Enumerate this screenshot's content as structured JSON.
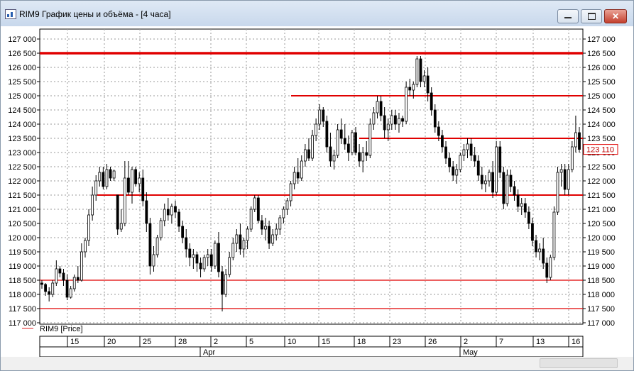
{
  "window": {
    "title": "RIM9 График цены и объёма - [4 часа]"
  },
  "legend": {
    "series_label": "RIM9 [Price]",
    "line_color": "#e02020"
  },
  "colors": {
    "candle": "#000000",
    "level": "#e00000",
    "grid": "#9a9a9a"
  },
  "chart_data": {
    "type": "candlestick",
    "title": "",
    "ylim": [
      117000,
      127000
    ],
    "yticks": [
      117000,
      117500,
      118000,
      118500,
      119000,
      119500,
      120000,
      120500,
      121000,
      121500,
      122000,
      122500,
      123000,
      123500,
      124000,
      124500,
      125000,
      125500,
      126000,
      126500,
      127000
    ],
    "last_price": "123 110",
    "xtick_labels": [
      "15",
      "20",
      "25",
      "28",
      "2",
      "5",
      "10",
      "15",
      "18",
      "23",
      "26",
      "2",
      "7",
      "13",
      "16"
    ],
    "month_labels": [
      "Apr",
      "May"
    ],
    "levels": [
      {
        "value": 126500,
        "thickness": "thick"
      },
      {
        "value": 125000,
        "thickness": "medium"
      },
      {
        "value": 123500,
        "thickness": "medium"
      },
      {
        "value": 121500,
        "thickness": "medium"
      },
      {
        "value": 118500,
        "thickness": "thin"
      },
      {
        "value": 117500,
        "thickness": "thin"
      }
    ],
    "candles": [
      [
        1,
        118400,
        118500,
        118200,
        118350
      ],
      [
        2,
        118350,
        118400,
        117950,
        118100
      ],
      [
        3,
        118100,
        118250,
        117750,
        118000
      ],
      [
        4,
        118000,
        118500,
        117900,
        118400
      ],
      [
        5,
        118400,
        119200,
        118300,
        118900
      ],
      [
        6,
        118900,
        119000,
        118600,
        118750
      ],
      [
        7,
        118750,
        118900,
        118300,
        118500
      ],
      [
        8,
        118500,
        118700,
        117800,
        117900
      ],
      [
        9,
        117900,
        118300,
        117850,
        118200
      ],
      [
        10,
        118200,
        118700,
        118100,
        118600
      ],
      [
        11,
        118600,
        119000,
        118400,
        118500
      ],
      [
        12,
        118500,
        119800,
        118450,
        119500
      ],
      [
        13,
        119500,
        120000,
        119300,
        119900
      ],
      [
        14,
        119900,
        121000,
        119700,
        120800
      ],
      [
        15,
        120800,
        121800,
        120600,
        121500
      ],
      [
        16,
        121500,
        122200,
        121300,
        122000
      ],
      [
        17,
        122000,
        122500,
        121800,
        122300
      ],
      [
        18,
        122300,
        122500,
        121700,
        121800
      ],
      [
        19,
        121800,
        122600,
        121700,
        122400
      ],
      [
        20,
        122400,
        122500,
        122000,
        122100
      ],
      [
        21,
        122100,
        122400,
        122000,
        122350
      ],
      [
        22,
        121500,
        120400,
        120100,
        120300
      ],
      [
        23,
        120300,
        121000,
        120200,
        120500
      ],
      [
        24,
        120500,
        122700,
        120400,
        122100
      ],
      [
        25,
        122100,
        122700,
        121500,
        121600
      ],
      [
        26,
        121600,
        122500,
        121200,
        122400
      ],
      [
        27,
        122400,
        122500,
        121800,
        121900
      ],
      [
        28,
        121900,
        122300,
        121600,
        122100
      ],
      [
        29,
        122100,
        122400,
        121100,
        121300
      ],
      [
        30,
        121300,
        121600,
        120200,
        120500
      ],
      [
        31,
        120500,
        120700,
        118700,
        119000
      ],
      [
        32,
        119000,
        119700,
        118800,
        119400
      ],
      [
        33,
        119400,
        120100,
        119300,
        120000
      ],
      [
        34,
        120000,
        120700,
        119900,
        120600
      ],
      [
        35,
        120600,
        121200,
        120400,
        121000
      ],
      [
        36,
        121000,
        121400,
        120600,
        120800
      ],
      [
        37,
        120800,
        121200,
        120500,
        121100
      ],
      [
        38,
        121100,
        121300,
        120700,
        120900
      ],
      [
        39,
        120900,
        121000,
        120200,
        120400
      ],
      [
        40,
        120400,
        120600,
        119800,
        120000
      ],
      [
        41,
        120000,
        120300,
        119300,
        119600
      ],
      [
        42,
        119600,
        119800,
        119000,
        119300
      ],
      [
        43,
        119300,
        119600,
        118900,
        119400
      ],
      [
        44,
        119400,
        119500,
        118800,
        119100
      ],
      [
        45,
        119100,
        119300,
        118600,
        118900
      ],
      [
        46,
        118900,
        119400,
        118800,
        119300
      ],
      [
        47,
        119300,
        119600,
        119000,
        119400
      ],
      [
        48,
        119400,
        119600,
        118800,
        119000
      ],
      [
        49,
        119000,
        119900,
        118900,
        119800
      ],
      [
        50,
        119800,
        120200,
        118600,
        118800
      ],
      [
        51,
        118800,
        119000,
        117400,
        118000
      ],
      [
        52,
        118000,
        118900,
        117900,
        118700
      ],
      [
        53,
        118700,
        119500,
        118600,
        119300
      ],
      [
        54,
        119300,
        120000,
        119200,
        119800
      ],
      [
        55,
        119800,
        120300,
        119500,
        120100
      ],
      [
        56,
        120100,
        120500,
        119400,
        119600
      ],
      [
        57,
        119600,
        120000,
        119300,
        119900
      ],
      [
        58,
        119900,
        120400,
        119600,
        120300
      ],
      [
        59,
        120300,
        121100,
        120200,
        121000
      ],
      [
        60,
        121000,
        121500,
        120900,
        121400
      ],
      [
        61,
        121400,
        121500,
        120500,
        120600
      ],
      [
        62,
        120600,
        120800,
        120100,
        120300
      ],
      [
        63,
        120300,
        120700,
        119900,
        120400
      ],
      [
        64,
        120400,
        120600,
        119600,
        119800
      ],
      [
        65,
        119800,
        120300,
        119700,
        120100
      ],
      [
        66,
        120100,
        120500,
        119900,
        120300
      ],
      [
        67,
        120300,
        120800,
        120100,
        120700
      ],
      [
        68,
        120700,
        121100,
        120500,
        121000
      ],
      [
        69,
        121000,
        121400,
        120800,
        121300
      ],
      [
        70,
        121300,
        122000,
        121100,
        121900
      ],
      [
        71,
        121900,
        122500,
        121700,
        122300
      ],
      [
        72,
        122300,
        122800,
        121900,
        122100
      ],
      [
        73,
        122100,
        122900,
        122000,
        122700
      ],
      [
        74,
        122700,
        123300,
        122500,
        123100
      ],
      [
        75,
        123100,
        123500,
        122700,
        122800
      ],
      [
        76,
        122800,
        123800,
        122700,
        123600
      ],
      [
        77,
        123600,
        124200,
        123400,
        124000
      ],
      [
        78,
        124000,
        124700,
        123800,
        124500
      ],
      [
        79,
        124500,
        124600,
        123900,
        124100
      ],
      [
        80,
        124100,
        124300,
        123000,
        123200
      ],
      [
        81,
        123200,
        123700,
        122500,
        122700
      ],
      [
        82,
        122700,
        123100,
        122400,
        122900
      ],
      [
        83,
        122900,
        124000,
        122800,
        123800
      ],
      [
        84,
        123800,
        124200,
        123300,
        123500
      ],
      [
        85,
        123500,
        124000,
        123100,
        123300
      ],
      [
        86,
        123300,
        123600,
        122700,
        123000
      ],
      [
        87,
        123000,
        123800,
        122900,
        123700
      ],
      [
        88,
        123700,
        123900,
        122900,
        123000
      ],
      [
        89,
        123000,
        123300,
        122500,
        122700
      ],
      [
        90,
        122700,
        123200,
        122300,
        123000
      ],
      [
        91,
        123000,
        123400,
        122700,
        122900
      ],
      [
        92,
        122900,
        124200,
        122800,
        124000
      ],
      [
        93,
        124000,
        124600,
        123800,
        124400
      ],
      [
        94,
        124400,
        125000,
        124200,
        124800
      ],
      [
        95,
        124800,
        125000,
        124100,
        124300
      ],
      [
        96,
        124300,
        124600,
        123500,
        123800
      ],
      [
        97,
        123800,
        124200,
        123400,
        124000
      ],
      [
        98,
        124000,
        124500,
        123800,
        124300
      ],
      [
        99,
        124300,
        124500,
        123800,
        124000
      ],
      [
        100,
        124000,
        124400,
        123700,
        124200
      ],
      [
        101,
        124200,
        124300,
        123900,
        124100
      ],
      [
        102,
        124100,
        125500,
        124000,
        125300
      ],
      [
        103,
        125300,
        125600,
        125000,
        125200
      ],
      [
        104,
        125200,
        125500,
        124900,
        125400
      ],
      [
        105,
        125400,
        126400,
        125300,
        126300
      ],
      [
        106,
        126300,
        126400,
        125300,
        125500
      ],
      [
        107,
        125500,
        125900,
        125300,
        125700
      ],
      [
        108,
        125700,
        126000,
        124800,
        125100
      ],
      [
        109,
        125100,
        125300,
        124300,
        124500
      ],
      [
        110,
        124500,
        124700,
        123700,
        123900
      ],
      [
        111,
        123900,
        124100,
        123400,
        123600
      ],
      [
        112,
        123600,
        123800,
        123000,
        123200
      ],
      [
        113,
        123200,
        123400,
        122600,
        122800
      ],
      [
        114,
        122800,
        123000,
        122300,
        122500
      ],
      [
        115,
        122500,
        122700,
        122000,
        122200
      ],
      [
        116,
        122200,
        122600,
        121900,
        122400
      ],
      [
        117,
        122400,
        123000,
        122300,
        122900
      ],
      [
        118,
        122900,
        123300,
        122700,
        123100
      ],
      [
        119,
        123100,
        123500,
        122800,
        123300
      ],
      [
        120,
        123300,
        123500,
        122700,
        122900
      ],
      [
        121,
        122900,
        123200,
        122500,
        122700
      ],
      [
        122,
        122700,
        122900,
        122000,
        122200
      ],
      [
        123,
        122200,
        122500,
        121700,
        121900
      ],
      [
        124,
        121900,
        122200,
        121600,
        122000
      ],
      [
        125,
        122000,
        122400,
        121800,
        122300
      ],
      [
        126,
        122300,
        122700,
        121400,
        121600
      ],
      [
        127,
        121600,
        123400,
        121500,
        123200
      ],
      [
        128,
        123200,
        123400,
        122100,
        122300
      ],
      [
        129,
        122300,
        122500,
        121000,
        121200
      ],
      [
        130,
        121200,
        122400,
        121100,
        122200
      ],
      [
        131,
        122200,
        122400,
        121600,
        121800
      ],
      [
        132,
        121800,
        122000,
        121300,
        121500
      ],
      [
        133,
        121500,
        121700,
        120900,
        121100
      ],
      [
        134,
        121100,
        121400,
        120800,
        121200
      ],
      [
        135,
        121200,
        121400,
        120700,
        120900
      ],
      [
        136,
        120900,
        121100,
        120300,
        120500
      ],
      [
        137,
        120500,
        120700,
        119700,
        119900
      ],
      [
        138,
        119900,
        120100,
        119300,
        119500
      ],
      [
        139,
        119500,
        119800,
        119200,
        119600
      ],
      [
        140,
        119600,
        120000,
        118900,
        119100
      ],
      [
        141,
        119100,
        119300,
        118400,
        118600
      ],
      [
        142,
        118600,
        119400,
        118500,
        119300
      ],
      [
        143,
        119300,
        121100,
        119200,
        120900
      ],
      [
        144,
        120900,
        122500,
        120800,
        122300
      ],
      [
        145,
        122300,
        122600,
        121800,
        122400
      ],
      [
        146,
        122400,
        122600,
        121500,
        121700
      ],
      [
        147,
        121700,
        122600,
        121500,
        122400
      ],
      [
        148,
        122400,
        123400,
        122300,
        123200
      ],
      [
        149,
        123200,
        124300,
        123000,
        123700
      ],
      [
        150,
        123700,
        123900,
        123000,
        123110
      ]
    ]
  }
}
